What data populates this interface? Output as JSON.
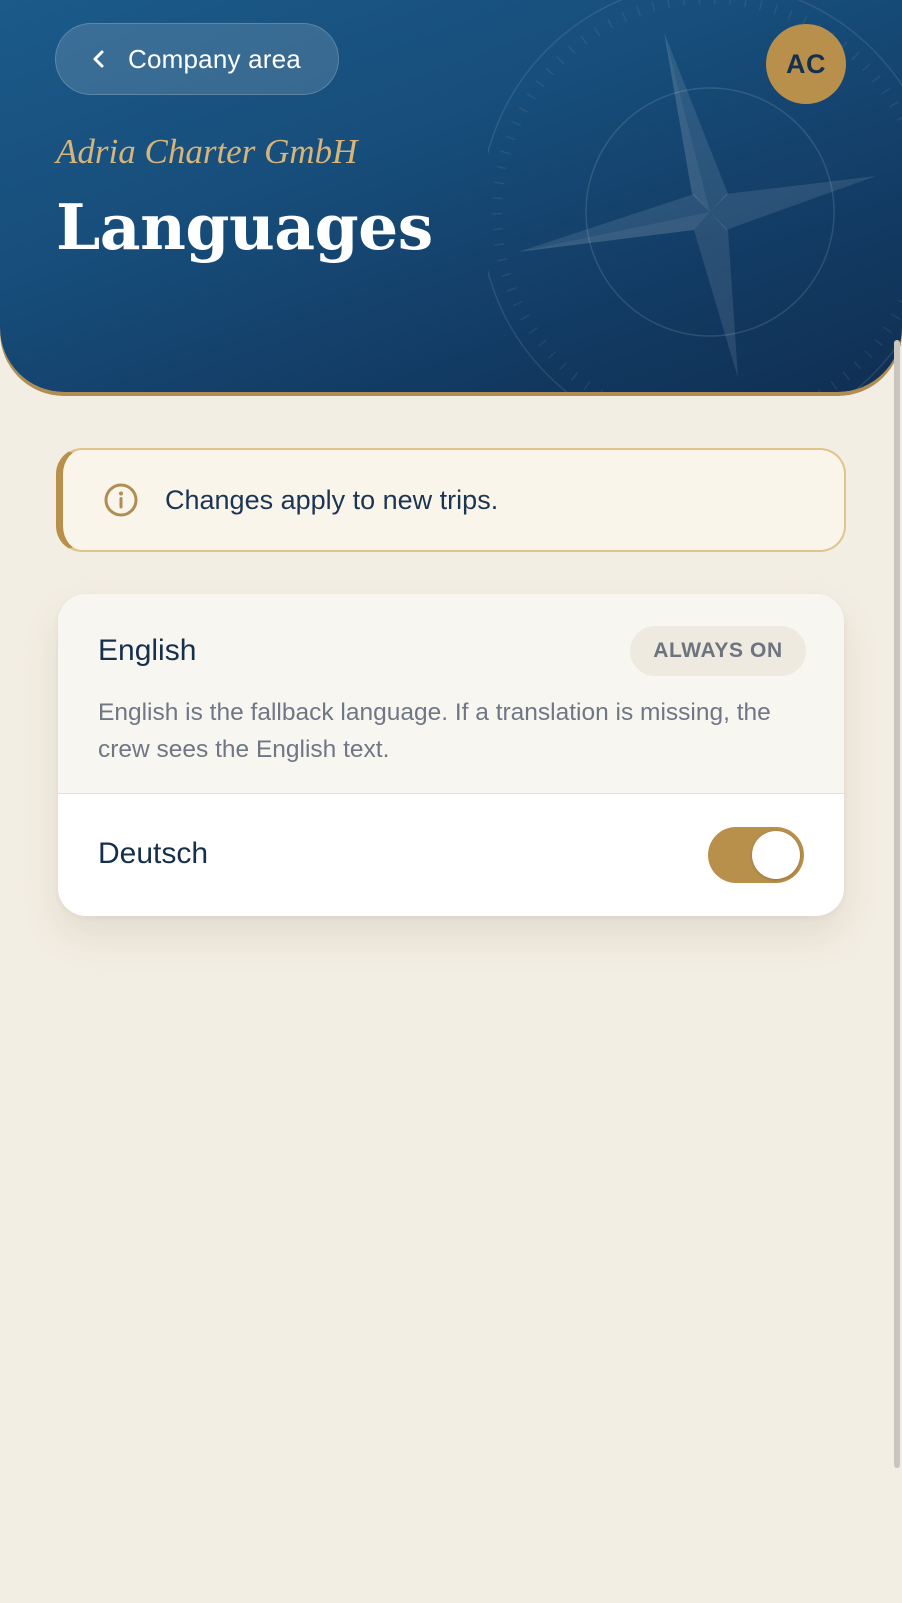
{
  "header": {
    "back_label": "Company area",
    "company": "Adria Charter GmbH",
    "title": "Languages",
    "avatar_initials": "AC"
  },
  "notice": {
    "icon": "info-icon",
    "text": "Changes apply to new trips."
  },
  "languages": [
    {
      "name": "English",
      "badge": "ALWAYS ON",
      "description": "English is the fallback language. If a translation is missing, the crew sees the English text."
    },
    {
      "name": "Deutsch",
      "enabled": true
    }
  ],
  "colors": {
    "header_blue": "#174d7a",
    "accent_gold": "#b98f4c",
    "background": "#f3eee3",
    "text_dark": "#16304b"
  }
}
